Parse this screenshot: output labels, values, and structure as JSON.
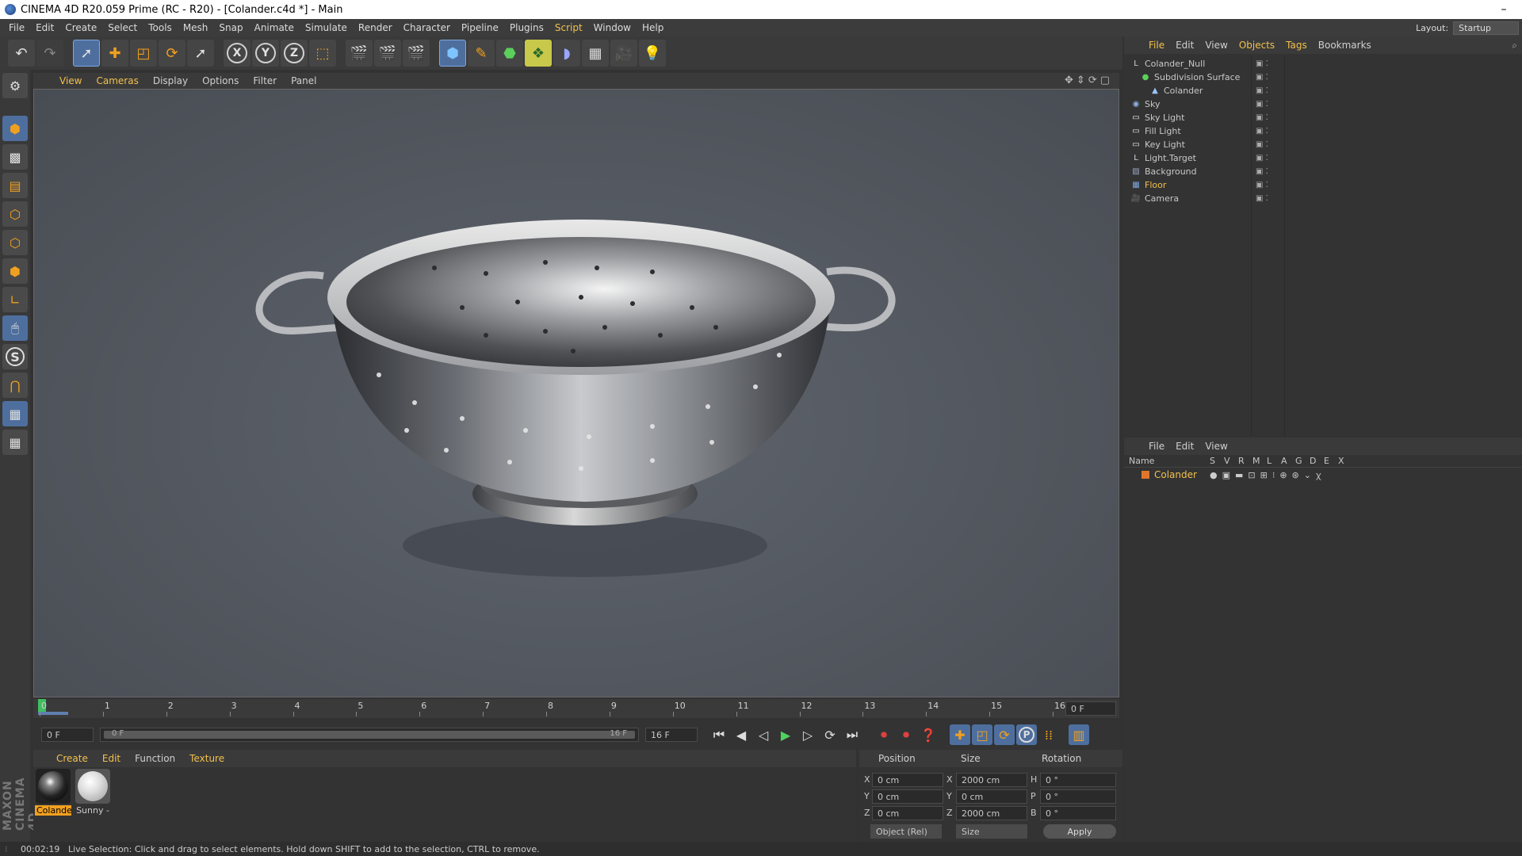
{
  "titlebar": {
    "title": "CINEMA 4D R20.059 Prime (RC - R20) - [Colander.c4d *] - Main",
    "minimize": "–"
  },
  "menubar": {
    "items": [
      "File",
      "Edit",
      "Create",
      "Select",
      "Tools",
      "Mesh",
      "Snap",
      "Animate",
      "Simulate",
      "Render",
      "Character",
      "Pipeline",
      "Plugins",
      "Script",
      "Window",
      "Help"
    ],
    "layout_label": "Layout:",
    "layout_value": "Startup"
  },
  "toolbar": {
    "axes": [
      "X",
      "Y",
      "Z"
    ],
    "p_label": "P",
    "s_label": "S"
  },
  "viewport": {
    "menu": [
      "View",
      "Cameras",
      "Display",
      "Options",
      "Filter",
      "Panel"
    ]
  },
  "timeline": {
    "ticks": [
      "0",
      "1",
      "2",
      "3",
      "4",
      "5",
      "6",
      "7",
      "8",
      "9",
      "10",
      "11",
      "12",
      "13",
      "14",
      "15",
      "16"
    ],
    "current_frame": "0 F",
    "start_frame": "0 F",
    "range_start": "0 F",
    "range_end": "16 F",
    "end_frame": "16 F"
  },
  "materials": {
    "menu": [
      "Create",
      "Edit",
      "Function",
      "Texture"
    ],
    "items": [
      {
        "label": "Colande",
        "selected": true
      },
      {
        "label": "Sunny -",
        "selected": false
      }
    ]
  },
  "coordinates": {
    "headers": {
      "position": "Position",
      "size": "Size",
      "rotation": "Rotation"
    },
    "rows": [
      {
        "axis": "X",
        "pos": "0 cm",
        "size_axis": "X",
        "size": "2000 cm",
        "rot_axis": "H",
        "rot": "0 °"
      },
      {
        "axis": "Y",
        "pos": "0 cm",
        "size_axis": "Y",
        "size": "0 cm",
        "rot_axis": "P",
        "rot": "0 °"
      },
      {
        "axis": "Z",
        "pos": "0 cm",
        "size_axis": "Z",
        "size": "2000 cm",
        "rot_axis": "B",
        "rot": "0 °"
      }
    ],
    "mode": "Object (Rel)",
    "size_mode": "Size",
    "apply": "Apply"
  },
  "object_manager": {
    "menu": [
      "File",
      "Edit",
      "View",
      "Objects",
      "Tags",
      "Bookmarks"
    ],
    "objects": [
      {
        "name": "Colander_Null",
        "icon": "null-icon",
        "depth": 0,
        "color": "#c8c8c8"
      },
      {
        "name": "Subdivision Surface",
        "icon": "subdivision-icon",
        "depth": 1,
        "color": "#c8c8c8"
      },
      {
        "name": "Colander",
        "icon": "polygon-icon",
        "depth": 2,
        "color": "#c8c8c8"
      },
      {
        "name": "Sky",
        "icon": "sky-icon",
        "depth": 0,
        "color": "#c8c8c8"
      },
      {
        "name": "Sky Light",
        "icon": "light-icon",
        "depth": 0,
        "color": "#c8c8c8"
      },
      {
        "name": "Fill Light",
        "icon": "light-icon",
        "depth": 0,
        "color": "#c8c8c8"
      },
      {
        "name": "Key Light",
        "icon": "light-icon",
        "depth": 0,
        "color": "#c8c8c8"
      },
      {
        "name": "Light.Target",
        "icon": "null-icon",
        "depth": 0,
        "color": "#c8c8c8"
      },
      {
        "name": "Background",
        "icon": "background-icon",
        "depth": 0,
        "color": "#c8c8c8"
      },
      {
        "name": "Floor",
        "icon": "floor-icon",
        "depth": 0,
        "color": "#f2c14e"
      },
      {
        "name": "Camera",
        "icon": "camera-icon",
        "depth": 0,
        "color": "#c8c8c8"
      }
    ]
  },
  "layer_manager": {
    "menu": [
      "File",
      "Edit",
      "View"
    ],
    "columns": [
      "Name",
      "S",
      "V",
      "R",
      "M",
      "L",
      "A",
      "G",
      "D",
      "E",
      "X"
    ],
    "layer_name": "Colander",
    "layer_color": "#e0762b"
  },
  "statusbar": {
    "time": "00:02:19",
    "message": "Live Selection: Click and drag to select elements. Hold down SHIFT to add to the selection, CTRL to remove."
  }
}
